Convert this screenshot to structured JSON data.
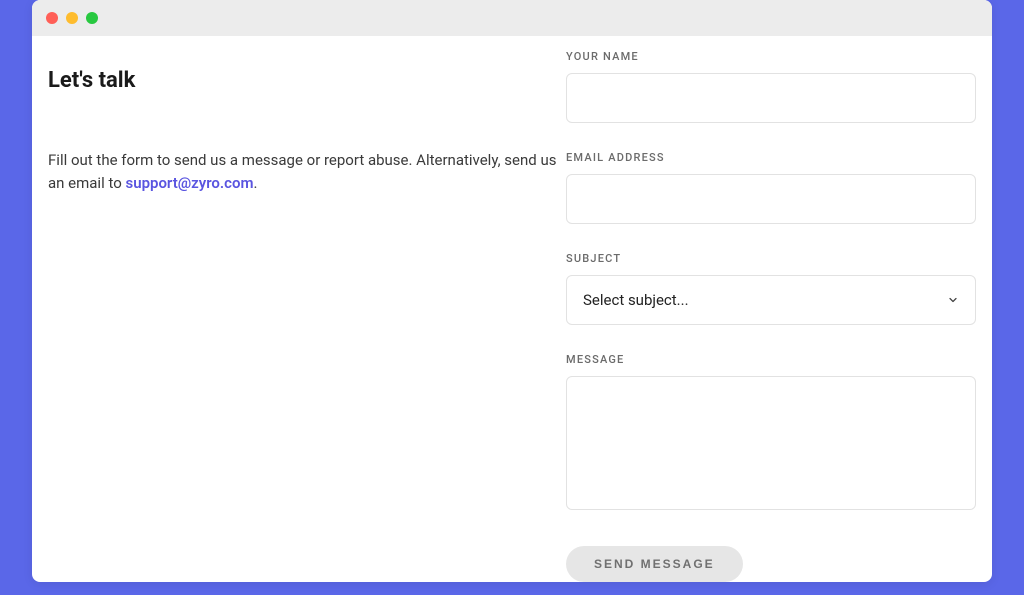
{
  "left": {
    "title": "Let's talk",
    "intro_before": "Fill out the form to send us a message or report abuse. Alternatively, send us an email to ",
    "email_link_text": "support@zyro.com",
    "intro_after": "."
  },
  "form": {
    "name": {
      "label": "YOUR NAME",
      "value": ""
    },
    "email": {
      "label": "EMAIL ADDRESS",
      "value": ""
    },
    "subject": {
      "label": "SUBJECT",
      "selected": "Select subject..."
    },
    "message": {
      "label": "MESSAGE",
      "value": ""
    },
    "submit_label": "SEND MESSAGE"
  }
}
